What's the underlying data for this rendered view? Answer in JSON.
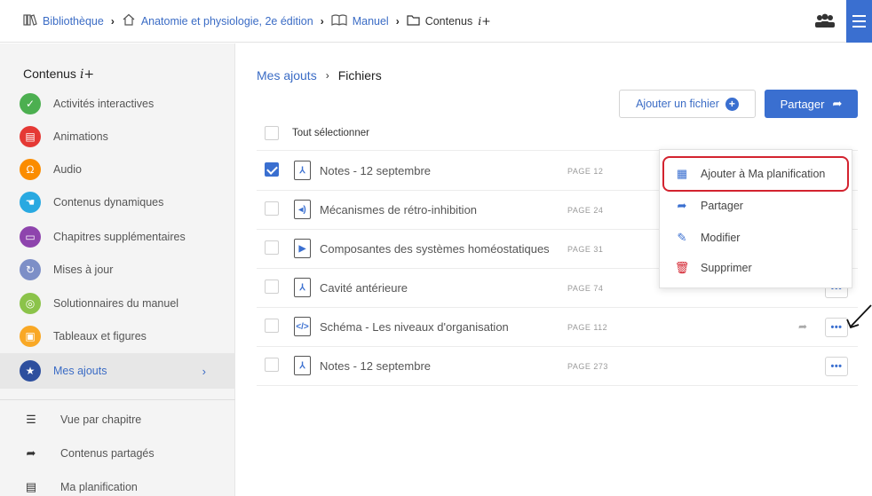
{
  "breadcrumb": {
    "items": [
      {
        "label": "Bibliothèque",
        "icon": "library-icon"
      },
      {
        "label": "Anatomie et physiologie, 2e édition",
        "icon": "home-icon"
      },
      {
        "label": "Manuel",
        "icon": "book-icon"
      },
      {
        "label": "Contenus",
        "icon": "folder-icon"
      }
    ],
    "suffix": "i+"
  },
  "sidebar": {
    "title": "Contenus",
    "title_suffix": "i+",
    "categories": [
      {
        "label": "Activités interactives",
        "color": "#4caf50",
        "icon": "check-icon"
      },
      {
        "label": "Animations",
        "color": "#e53935",
        "icon": "film-icon"
      },
      {
        "label": "Audio",
        "color": "#fb8c00",
        "icon": "headphones-icon"
      },
      {
        "label": "Contenus dynamiques",
        "color": "#29a9e1",
        "icon": "hand-icon"
      },
      {
        "label": "Chapitres supplémentaires",
        "color": "#8e44ad",
        "icon": "document-icon"
      },
      {
        "label": "Mises à jour",
        "color": "#7d8fc7",
        "icon": "refresh-icon"
      },
      {
        "label": "Solutionnaires du manuel",
        "color": "#8bc34a",
        "icon": "target-icon"
      },
      {
        "label": "Tableaux et figures",
        "color": "#f9a825",
        "icon": "image-icon"
      },
      {
        "label": "Mes ajouts",
        "color": "#2d4f9e",
        "icon": "star-icon"
      }
    ],
    "links": [
      {
        "label": "Vue par chapitre",
        "icon": "list-icon"
      },
      {
        "label": "Contenus partagés",
        "icon": "share-icon"
      },
      {
        "label": "Ma planification",
        "icon": "clipboard-icon"
      }
    ]
  },
  "main": {
    "crumb_link": "Mes ajouts",
    "crumb_current": "Fichiers",
    "add_file_label": "Ajouter un fichier",
    "share_label": "Partager",
    "select_all": "Tout sélectionner",
    "files": [
      {
        "name": "Notes - 12 septembre",
        "page": "PAGE 12",
        "type": "pdf-icon",
        "checked": true
      },
      {
        "name": "Mécanismes de rétro-inhibition",
        "page": "PAGE 24",
        "type": "audio-file-icon",
        "checked": false
      },
      {
        "name": "Composantes des systèmes homéostatiques",
        "page": "PAGE 31",
        "type": "video-file-icon",
        "checked": false
      },
      {
        "name": "Cavité antérieure",
        "page": "PAGE 74",
        "type": "pdf-icon",
        "checked": false
      },
      {
        "name": "Schéma - Les niveaux d'organisation",
        "page": "PAGE 112",
        "type": "code-file-icon",
        "checked": false
      },
      {
        "name": "Notes - 12 septembre",
        "page": "PAGE 273",
        "type": "pdf-icon",
        "checked": false
      }
    ]
  },
  "context_menu": {
    "items": [
      {
        "label": "Ajouter à Ma planification",
        "icon": "planner-add-icon"
      },
      {
        "label": "Partager",
        "icon": "share-icon"
      },
      {
        "label": "Modifier",
        "icon": "edit-icon"
      },
      {
        "label": "Supprimer",
        "icon": "trash-icon"
      }
    ],
    "highlight_color": "#d3232f"
  },
  "colors": {
    "accent": "#3a6fd0",
    "link": "#3b6cc5"
  }
}
